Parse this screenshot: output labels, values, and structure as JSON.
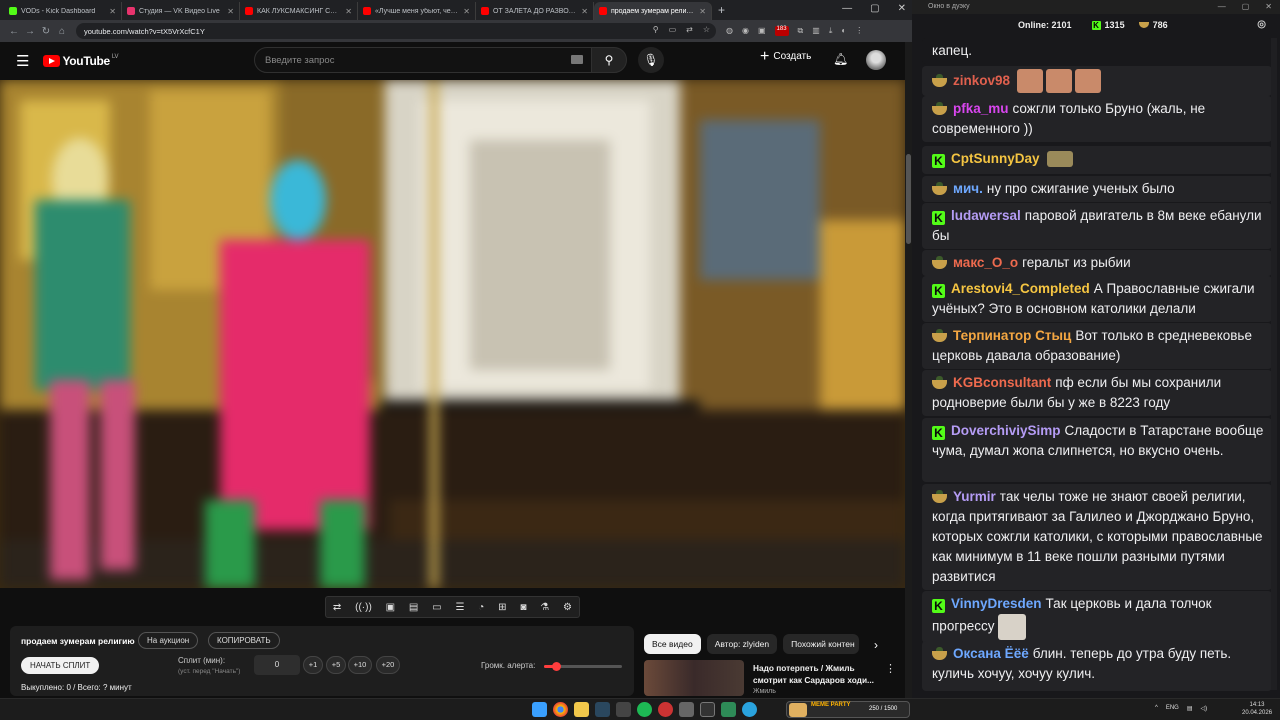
{
  "tabs": [
    {
      "title": "VODs - Kick Dashboard",
      "color": "#53fc18"
    },
    {
      "title": "Студия — VK Видео Live",
      "color": "#e8336d"
    },
    {
      "title": "КАК ЛУКСМАКСИНГ СДЕЛАЛ",
      "color": "#ff0000"
    },
    {
      "title": "«Лучше меня убьют, чем на н",
      "color": "#ff0000"
    },
    {
      "title": "ОТ ЗАЛЕТА ДО РАЗВОДА: пол",
      "color": "#ff0000"
    },
    {
      "title": "продаем зумерам религию -",
      "color": "#ff0000"
    }
  ],
  "url": "youtube.com/watch?v=tX5VrXcfC1Y",
  "extension_badge": "183",
  "youtube": {
    "logo_text": "YouTube",
    "logo_region": "LV",
    "search_placeholder": "Введите запрос",
    "create_label": "Создать"
  },
  "panel": {
    "title": "продаем зумерам религию",
    "auction_label": "На аукцион",
    "copy_label": "КОПИРОВАТЬ",
    "start_split_label": "НАЧАТЬ СПЛИТ",
    "split_label": "Сплит (мин):",
    "split_hint": "(уст. перед \"Начать\")",
    "split_value": "0",
    "increments": [
      "+1",
      "+5",
      "+10",
      "+20"
    ],
    "volume_label": "Громк. алерта:",
    "volume_level": 0.15,
    "status": "Выкуплено: 0 / Всего: ? минут"
  },
  "chips": [
    "Все видео",
    "Автор: zlyiden",
    "Похожий контен"
  ],
  "recommendation": {
    "title": "Надо потерпеть / Жмиль смотрит как Сардаров ходи...",
    "channel": "Жмиль"
  },
  "chat": {
    "window_title": "Окно в дуэку",
    "online_label": "Online:",
    "online_count": "2101",
    "kick_count": "1315",
    "other_count": "786",
    "messages": [
      {
        "badge": "none",
        "user": "",
        "color": "#efeff1",
        "text": "капец."
      },
      {
        "badge": "cup",
        "user": "zinkov98",
        "color": "#e0604e",
        "text": ""
      },
      {
        "badge": "cup",
        "user": "pfka_mu",
        "color": "#d946ef",
        "text": "сожгли только Бруно (жаль, не современного ))"
      },
      {
        "badge": "kick",
        "user": "CptSunnyDay",
        "color": "#f5c542",
        "text": ""
      },
      {
        "badge": "cup",
        "user": "мич.",
        "color": "#6ea8ff",
        "text": "ну про сжигание ученых было"
      },
      {
        "badge": "kick",
        "user": "ludawersal",
        "color": "#b59cf5",
        "text": "паровой двигатель в 8м веке ебанули бы"
      },
      {
        "badge": "cup",
        "user": "макс_O_o",
        "color": "#ee6a4e",
        "text": "геральт из рыбии"
      },
      {
        "badge": "kick",
        "user": "Arestovi4_Completed",
        "color": "#f5c542",
        "text": "А Православные сжигали учёных? Это в основном католики делали"
      },
      {
        "badge": "cup",
        "user": "Терпинатор Стыц",
        "color": "#f5a742",
        "text": "Вот только в средневековье церковь давала образование)"
      },
      {
        "badge": "cup",
        "user": "KGBconsultant",
        "color": "#ee6a4e",
        "text": "пф если бы мы сохранили родноверие были бы у же в 8223 году"
      },
      {
        "badge": "kick",
        "user": "DoverchiviySimp",
        "color": "#b59cf5",
        "text": "Сладости в Татарстане вообще чума, думал жопа слипнется, но вкусно очень."
      },
      {
        "badge": "cup",
        "user": "Yurmir",
        "color": "#b59cf5",
        "text": "так челы тоже не знают своей религии, когда притягивают за Галилео и Джорджано Бруно, которых сожгли католики, с которыми православные как минимум в 11 веке пошли разными путями развитися"
      },
      {
        "badge": "kick",
        "user": "VinnyDresden",
        "color": "#6ea8ff",
        "text": "Так церковь и дала толчок прогрессу"
      },
      {
        "badge": "cup",
        "user": "Оксана Ёёё",
        "color": "#6ea8ff",
        "text": "блин. теперь до утра буду петь. куличь хочуу, хочуу кулич."
      }
    ]
  },
  "taskbar": {
    "meme_title": "MEME PARTY",
    "meme_count": "250 / 1500",
    "lang": "ENG",
    "time": "14:13",
    "date": "20.04.2026"
  }
}
